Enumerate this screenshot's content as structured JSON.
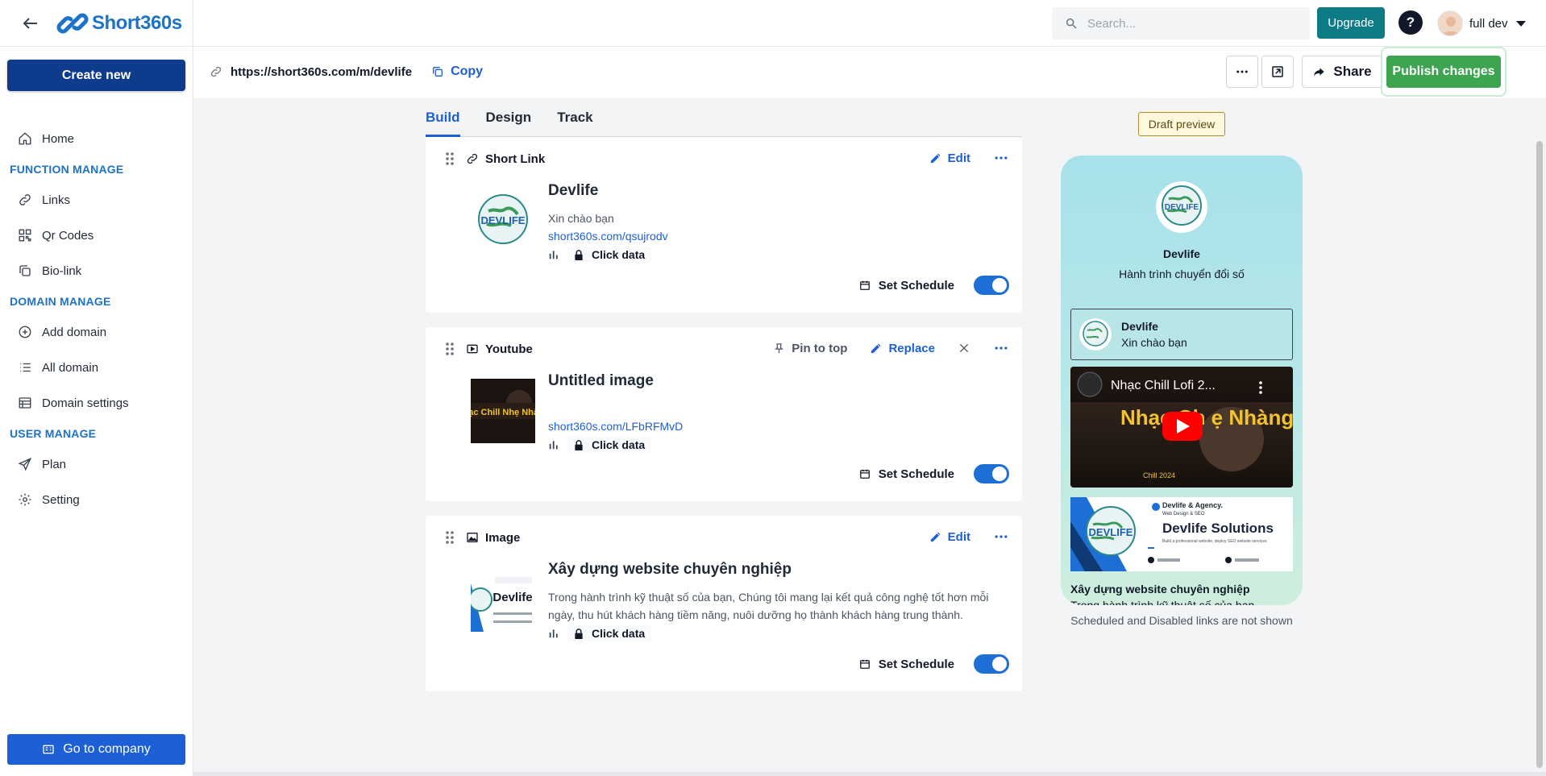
{
  "app": {
    "name": "Short360s"
  },
  "sidebar": {
    "create_label": "Create new",
    "items": [
      {
        "type": "item",
        "label": "Home",
        "icon": "home-icon"
      },
      {
        "type": "section",
        "label": "FUNCTION MANAGE"
      },
      {
        "type": "item",
        "label": "Links",
        "icon": "link-icon"
      },
      {
        "type": "item",
        "label": "Qr Codes",
        "icon": "qr-code-icon"
      },
      {
        "type": "item",
        "label": "Bio-link",
        "icon": "copy-icon"
      },
      {
        "type": "section",
        "label": "DOMAIN MANAGE"
      },
      {
        "type": "item",
        "label": "Add domain",
        "icon": "plus-circle-icon"
      },
      {
        "type": "item",
        "label": "All domain",
        "icon": "list-icon"
      },
      {
        "type": "item",
        "label": "Domain settings",
        "icon": "table-icon"
      },
      {
        "type": "section",
        "label": "USER MANAGE"
      },
      {
        "type": "item",
        "label": "Plan",
        "icon": "send-icon"
      },
      {
        "type": "item",
        "label": "Setting",
        "icon": "gear-icon"
      }
    ],
    "company_label": "Go to company"
  },
  "header": {
    "search_placeholder": "Search...",
    "upgrade_label": "Upgrade",
    "help_label": "?",
    "user_name": "full dev"
  },
  "toolbar": {
    "url": "https://short360s.com/m/devlife",
    "copy_label": "Copy",
    "share_label": "Share",
    "publish_label": "Publish changes"
  },
  "tabs": [
    {
      "label": "Build",
      "active": true
    },
    {
      "label": "Design",
      "active": false
    },
    {
      "label": "Track",
      "active": false
    }
  ],
  "cards": {
    "shortlink": {
      "type_label": "Short Link",
      "edit_label": "Edit",
      "title": "Devlife",
      "subtitle": "Xin chào bạn",
      "link": "short360s.com/qsujrodv",
      "click_label": "Click data",
      "schedule_label": "Set Schedule"
    },
    "youtube": {
      "type_label": "Youtube",
      "pin_label": "Pin to top",
      "replace_label": "Replace",
      "title": "Untitled image",
      "link": "short360s.com/LFbRFMvD",
      "click_label": "Click data",
      "schedule_label": "Set Schedule",
      "thumb_text": "Nhạc Chill Nhẹ Nhàng"
    },
    "image": {
      "type_label": "Image",
      "edit_label": "Edit",
      "title": "Xây dựng website chuyên nghiệp",
      "description": "Trong hành trình kỹ thuật số của bạn, Chúng tôi mang lại kết quả công nghệ tốt hơn mỗi ngày, thu hút khách hàng tiềm năng, nuôi dưỡng họ thành khách hàng trung thành.",
      "click_label": "Click data",
      "schedule_label": "Set Schedule",
      "thumb_text": "Devlife"
    }
  },
  "preview": {
    "draft_label": "Draft preview",
    "profile_name": "Devlife",
    "profile_bio": "Hành trình chuyển đổi số",
    "link_title": "Devlife",
    "link_sub": "Xin chào bạn",
    "video_title": "Nhạc Chill Lofi 2...",
    "video_overlay": "Nhạc Ch     ẹ Nhàng",
    "banner_brand": "Devlife & Agency.",
    "banner_tagline": "Web Design & SEO",
    "banner_title": "Devlife Solutions",
    "banner_desc": "Build a professional website, deploy SEO website services",
    "caption": "Xây dựng website chuyên nghiệp",
    "caption_sub": "Trong hành trình kỹ thuật số của bạn",
    "note": "Scheduled and Disabled links are not shown"
  },
  "colors": {
    "brand": "#1d73c8",
    "primary": "#1d5fd6",
    "publish": "#3da450",
    "upgrade": "#0e7c86",
    "create": "#0e3b8c"
  }
}
